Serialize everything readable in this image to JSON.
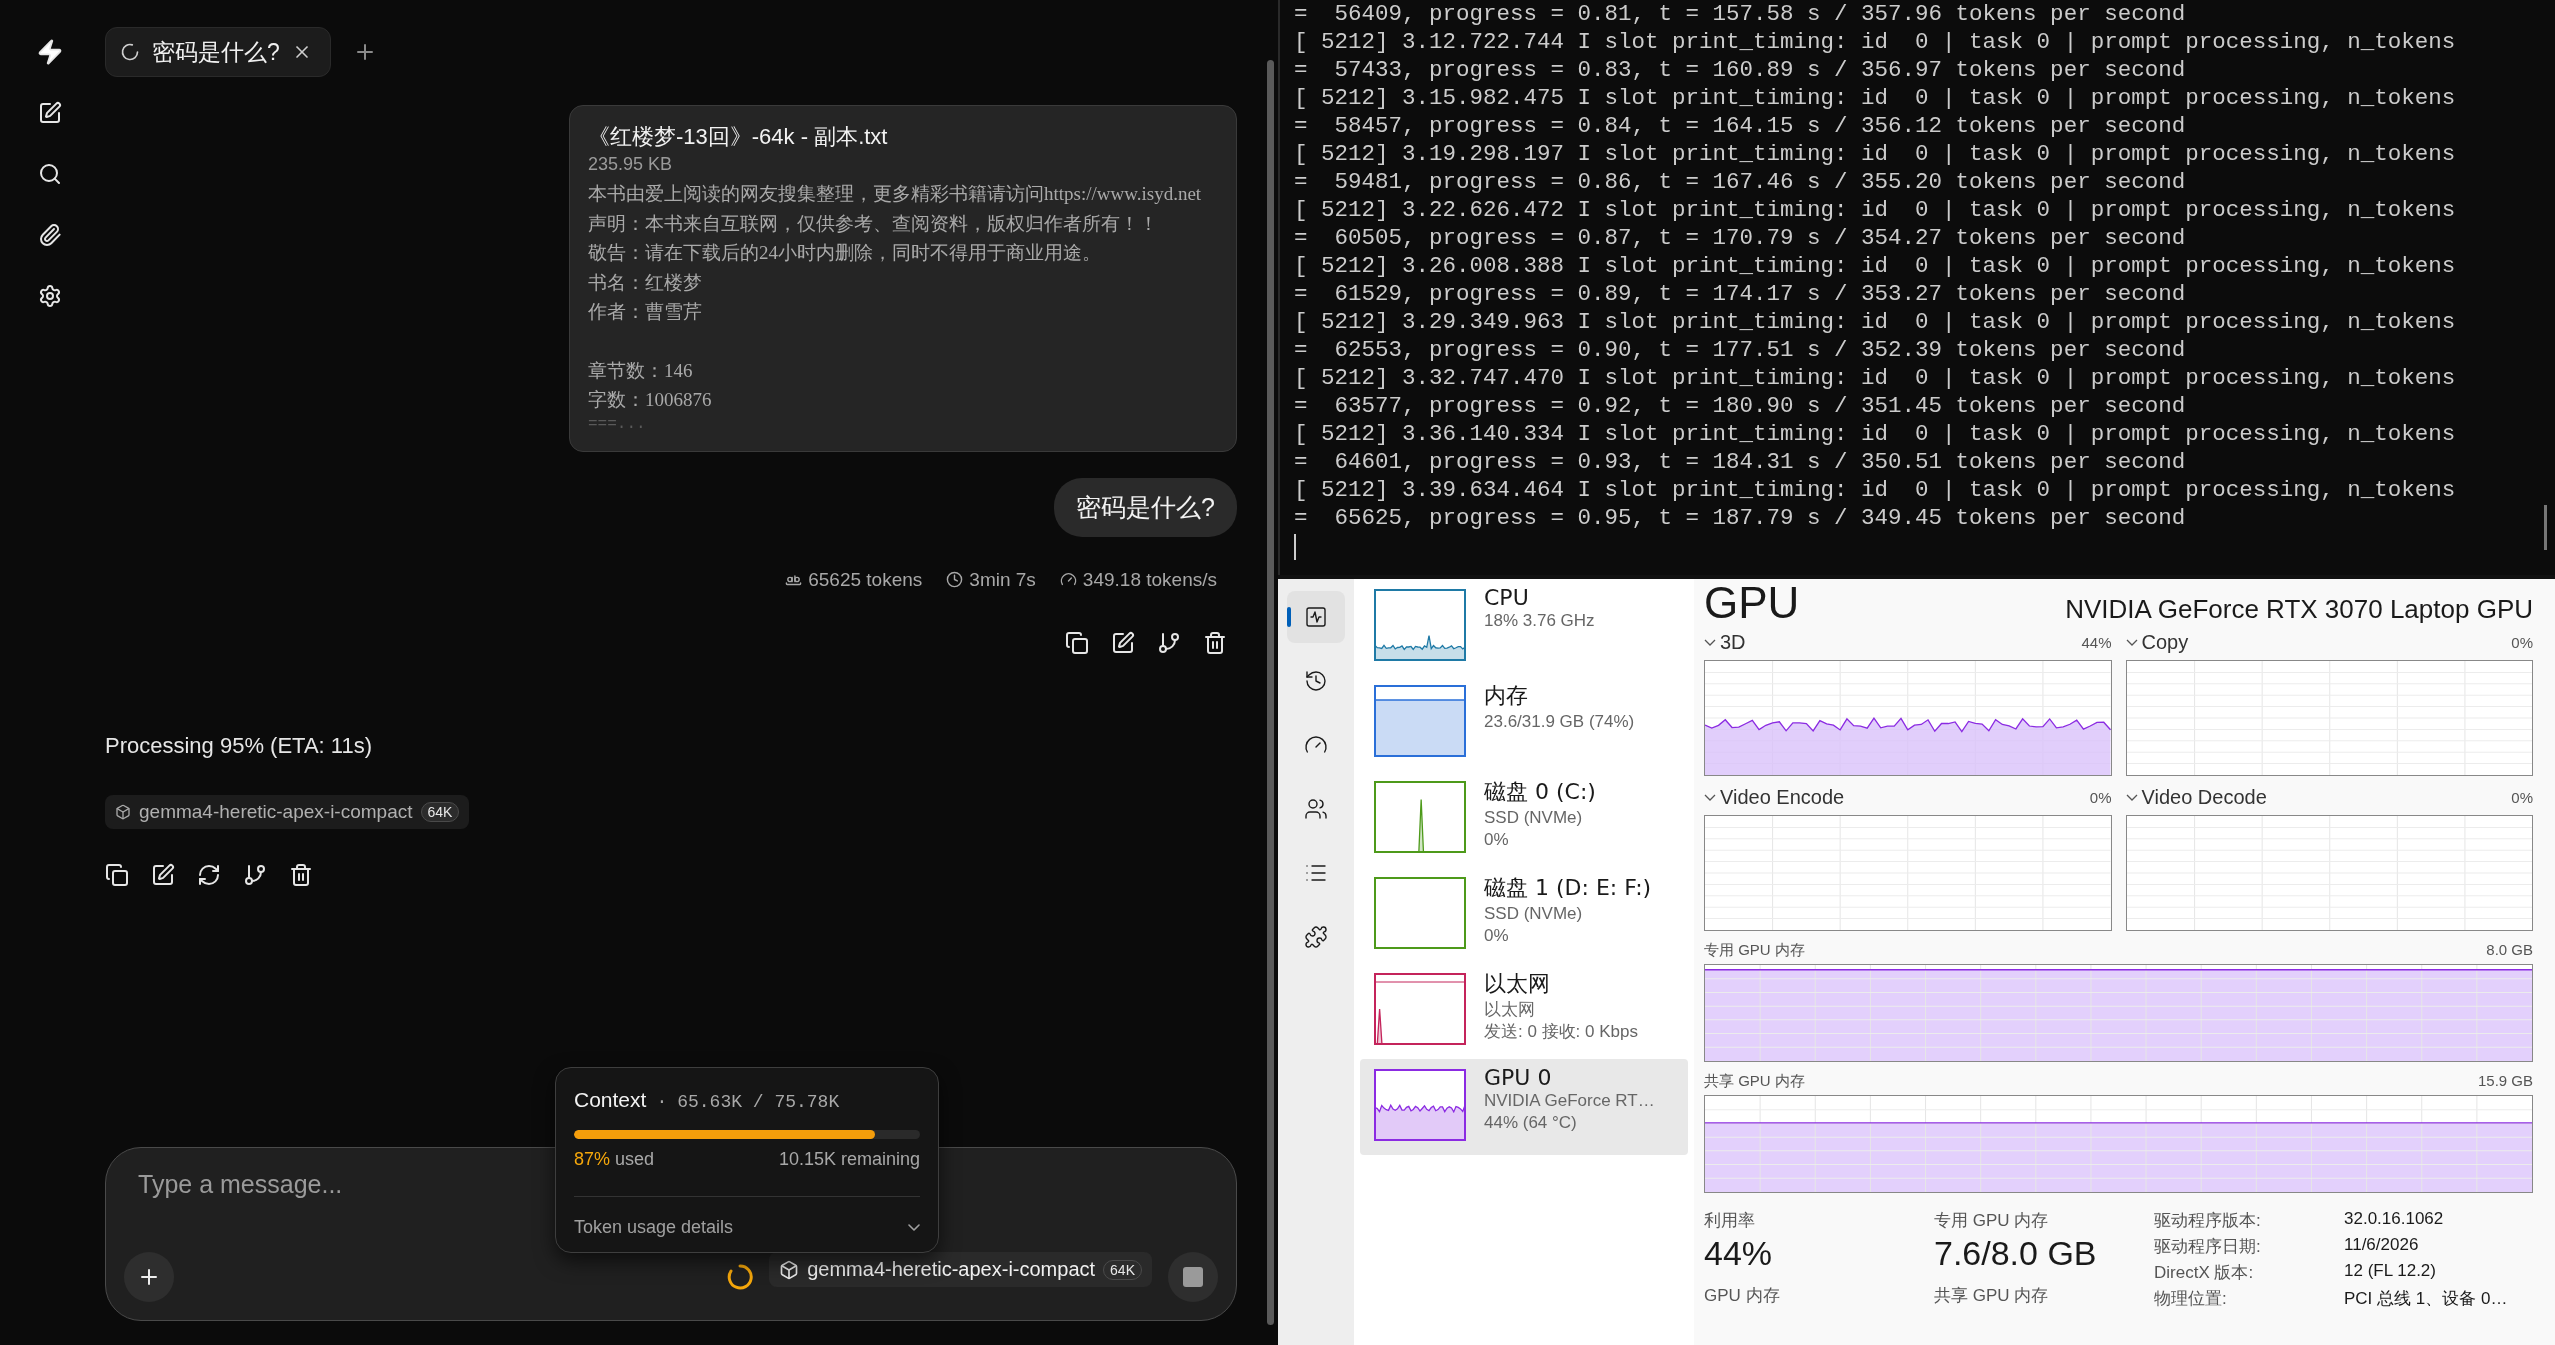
{
  "chat": {
    "tab": {
      "label": "密码是什么?"
    },
    "attachment": {
      "name": "《红楼梦-13回》-64k - 副本.txt",
      "size": "235.95 KB",
      "paragraphs": [
        [
          "本书由爱上阅读的网友搜集整理，更多精彩书籍请访问https://www.isyd.net",
          "声明：本书来自互联网，仅供参考、查阅资料，版权归作者所有！！",
          "敬告：请在下载后的24小时内删除，同时不得用于商业用途。",
          "书名：红楼梦",
          "作者：曹雪芹"
        ],
        [
          "章节数：146",
          "字数：1006876"
        ]
      ],
      "more": "===..."
    },
    "user_message": "密码是什么?",
    "stats": [
      {
        "kind": "tokens",
        "text": "65625 tokens"
      },
      {
        "kind": "time",
        "text": "3min 7s"
      },
      {
        "kind": "speed",
        "text": "349.18 tokens/s"
      }
    ],
    "status": "Processing 95% (ETA: 11s)",
    "model": {
      "name": "gemma4-heretic-apex-i-compact",
      "badge": "64K"
    },
    "context": {
      "title": "Context",
      "separator": "·",
      "value": "65.63K / 75.78K",
      "level": 0.87,
      "percent": "87%",
      "used_label": "used",
      "remaining": "10.15K remaining",
      "details": "Token usage details"
    },
    "composer": {
      "placeholder": "Type a message...",
      "model": {
        "name": "gemma4-heretic-apex-i-compact",
        "badge": "64K"
      }
    }
  },
  "terminal": {
    "lines": [
      "=  56409, progress = 0.81, t = 157.58 s / 357.96 tokens per second",
      "[ 5212] 3.12.722.744 I slot print_timing: id  0 | task 0 | prompt processing, n_tokens",
      "=  57433, progress = 0.83, t = 160.89 s / 356.97 tokens per second",
      "[ 5212] 3.15.982.475 I slot print_timing: id  0 | task 0 | prompt processing, n_tokens",
      "=  58457, progress = 0.84, t = 164.15 s / 356.12 tokens per second",
      "[ 5212] 3.19.298.197 I slot print_timing: id  0 | task 0 | prompt processing, n_tokens",
      "=  59481, progress = 0.86, t = 167.46 s / 355.20 tokens per second",
      "[ 5212] 3.22.626.472 I slot print_timing: id  0 | task 0 | prompt processing, n_tokens",
      "=  60505, progress = 0.87, t = 170.79 s / 354.27 tokens per second",
      "[ 5212] 3.26.008.388 I slot print_timing: id  0 | task 0 | prompt processing, n_tokens",
      "=  61529, progress = 0.89, t = 174.17 s / 353.27 tokens per second",
      "[ 5212] 3.29.349.963 I slot print_timing: id  0 | task 0 | prompt processing, n_tokens",
      "=  62553, progress = 0.90, t = 177.51 s / 352.39 tokens per second",
      "[ 5212] 3.32.747.470 I slot print_timing: id  0 | task 0 | prompt processing, n_tokens",
      "=  63577, progress = 0.92, t = 180.90 s / 351.45 tokens per second",
      "[ 5212] 3.36.140.334 I slot print_timing: id  0 | task 0 | prompt processing, n_tokens",
      "=  64601, progress = 0.93, t = 184.31 s / 350.51 tokens per second",
      "[ 5212] 3.39.634.464 I slot print_timing: id  0 | task 0 | prompt processing, n_tokens",
      "=  65625, progress = 0.95, t = 187.79 s / 349.45 tokens per second"
    ]
  },
  "task_manager": {
    "nav": [
      {
        "kind": "performance",
        "selected": true
      },
      {
        "kind": "history",
        "selected": false
      },
      {
        "kind": "startup",
        "selected": false
      },
      {
        "kind": "users",
        "selected": false
      },
      {
        "kind": "details",
        "selected": false
      },
      {
        "kind": "services",
        "selected": false
      }
    ],
    "devices": [
      {
        "kind": "cpu",
        "name": "CPU",
        "lines": [
          "18%  3.76 GHz"
        ],
        "color": "#1f7aa6",
        "selected": false
      },
      {
        "kind": "memory",
        "name": "内存",
        "lines": [
          "23.6/31.9 GB (74%)"
        ],
        "color": "#2a6fd8",
        "selected": false
      },
      {
        "kind": "disk",
        "name": "磁盘 0 (C:)",
        "lines": [
          "SSD (NVMe)",
          "0%"
        ],
        "color": "#4d9a1a",
        "selected": false
      },
      {
        "kind": "idle",
        "name": "磁盘 1 (D: E: F:)",
        "lines": [
          "SSD (NVMe)",
          "0%"
        ],
        "color": "#4d9a1a",
        "selected": false
      },
      {
        "kind": "network",
        "name": "以太网",
        "lines": [
          "以太网",
          "发送: 0 接收: 0 Kbps"
        ],
        "color": "#c4245b",
        "selected": false
      },
      {
        "kind": "gpu",
        "name": "GPU 0",
        "lines": [
          "NVIDIA GeForce RT…",
          "44% (64 °C)"
        ],
        "color": "#8b2be2",
        "selected": true
      }
    ],
    "detail": {
      "title": "GPU",
      "device": "NVIDIA GeForce RTX 3070 Laptop GPU",
      "engines": [
        {
          "name": "3D",
          "reading": "44%",
          "kind": "wave"
        },
        {
          "name": "Copy",
          "reading": "0%",
          "kind": "empty"
        },
        {
          "name": "Video Encode",
          "reading": "0%",
          "kind": "empty"
        },
        {
          "name": "Video Decode",
          "reading": "0%",
          "kind": "empty"
        }
      ],
      "memory": [
        {
          "label": "专用 GPU 内存",
          "max": "8.0 GB",
          "kind": "full"
        },
        {
          "label": "共享 GPU 内存",
          "max": "15.9 GB",
          "kind": "partial"
        }
      ],
      "stats": [
        {
          "label": "利用率",
          "value": "44%"
        },
        {
          "label": "专用 GPU 内存",
          "value": "7.6/8.0 GB"
        }
      ],
      "stats_next": [
        "GPU 内存",
        "共享 GPU 内存"
      ],
      "info": [
        {
          "label": "驱动程序版本:",
          "value": "32.0.16.1062"
        },
        {
          "label": "驱动程序日期:",
          "value": "11/6/2026"
        },
        {
          "label": "DirectX 版本:",
          "value": "12 (FL 12.2)"
        },
        {
          "label": "物理位置:",
          "value": "PCI 总线 1、设备 0…"
        }
      ]
    }
  }
}
